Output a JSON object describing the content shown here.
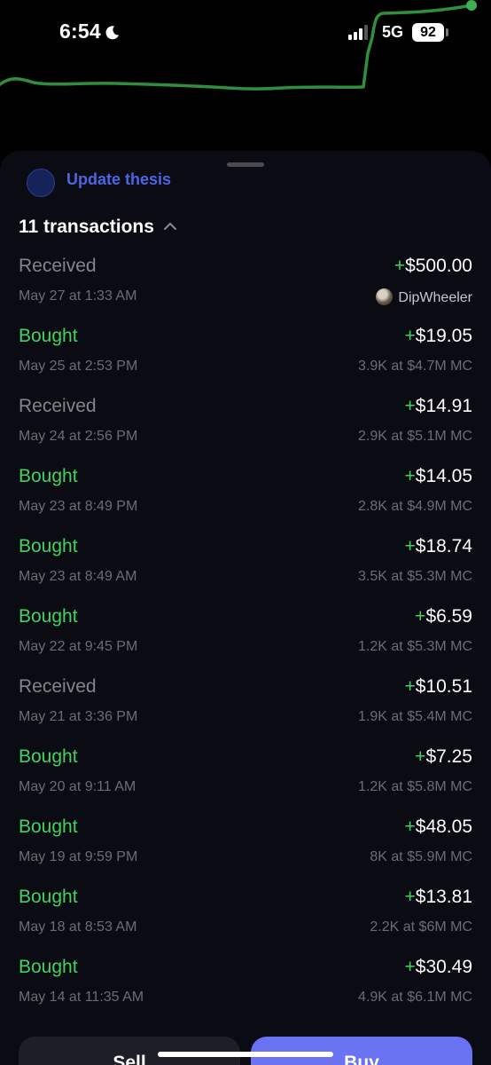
{
  "status_bar": {
    "time": "6:54",
    "network": "5G",
    "battery": "92"
  },
  "thesis": {
    "link_label": "Update thesis"
  },
  "transactions": {
    "header": "11 transactions",
    "items": [
      {
        "type": "Received",
        "kind": "received",
        "sign": "+",
        "amount": "$500.00",
        "date": "May 27 at 1:33 AM",
        "sender": "DipWheeler"
      },
      {
        "type": "Bought",
        "kind": "bought",
        "sign": "+",
        "amount": "$19.05",
        "date": "May 25 at 2:53 PM",
        "detail": "3.9K at $4.7M MC"
      },
      {
        "type": "Received",
        "kind": "received",
        "sign": "+",
        "amount": "$14.91",
        "date": "May 24 at 2:56 PM",
        "detail": "2.9K at $5.1M MC"
      },
      {
        "type": "Bought",
        "kind": "bought",
        "sign": "+",
        "amount": "$14.05",
        "date": "May 23 at 8:49 PM",
        "detail": "2.8K at $4.9M MC"
      },
      {
        "type": "Bought",
        "kind": "bought",
        "sign": "+",
        "amount": "$18.74",
        "date": "May 23 at 8:49 AM",
        "detail": "3.5K at $5.3M MC"
      },
      {
        "type": "Bought",
        "kind": "bought",
        "sign": "+",
        "amount": "$6.59",
        "date": "May 22 at 9:45 PM",
        "detail": "1.2K at $5.3M MC"
      },
      {
        "type": "Received",
        "kind": "received",
        "sign": "+",
        "amount": "$10.51",
        "date": "May 21 at 3:36 PM",
        "detail": "1.9K at $5.4M MC"
      },
      {
        "type": "Bought",
        "kind": "bought",
        "sign": "+",
        "amount": "$7.25",
        "date": "May 20 at 9:11 AM",
        "detail": "1.2K at $5.8M MC"
      },
      {
        "type": "Bought",
        "kind": "bought",
        "sign": "+",
        "amount": "$48.05",
        "date": "May 19 at 9:59 PM",
        "detail": "8K at $5.9M MC"
      },
      {
        "type": "Bought",
        "kind": "bought",
        "sign": "+",
        "amount": "$13.81",
        "date": "May 18 at 8:53 AM",
        "detail": "2.2K at $6M MC"
      },
      {
        "type": "Bought",
        "kind": "bought",
        "sign": "+",
        "amount": "$30.49",
        "date": "May 14 at 11:35 AM",
        "detail": "4.9K at $6.1M MC"
      }
    ]
  },
  "actions": {
    "sell_label": "Sell",
    "buy_label": "Buy"
  },
  "colors": {
    "accent_green": "#3fd361",
    "accent_blue": "#6a73f2",
    "link_blue": "#4d65e3"
  }
}
